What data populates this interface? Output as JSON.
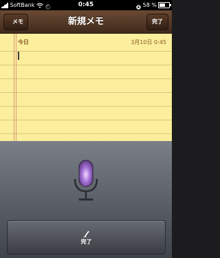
{
  "status_bar": {
    "carrier": "SoftBank",
    "time": "0:45",
    "battery_percent_label": "58 %",
    "battery_level": 0.58
  },
  "nav": {
    "back_label": "メモ",
    "title": "新規メモ",
    "done_label": "完了"
  },
  "note": {
    "date_label": "今日",
    "timestamp": "3月10日   0:45",
    "body": ""
  },
  "dictation": {
    "mic_icon": "microphone-icon",
    "done_icon": "pen-icon",
    "done_label": "完了"
  }
}
